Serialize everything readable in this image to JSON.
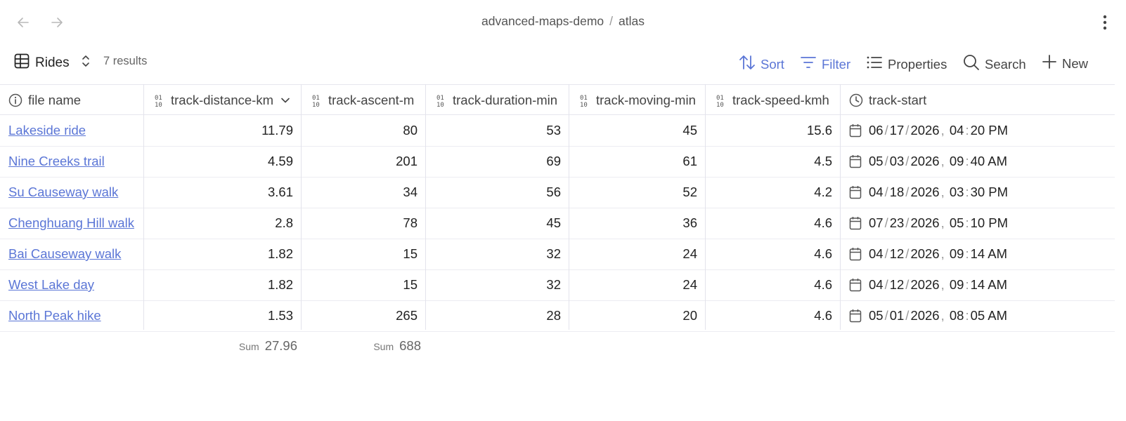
{
  "window": {
    "breadcrumb_project": "advanced-maps-demo",
    "breadcrumb_separator": "/",
    "breadcrumb_page": "atlas"
  },
  "toolbar": {
    "view_name": "Rides",
    "results": "7 results",
    "sort_label": "Sort",
    "filter_label": "Filter",
    "properties_label": "Properties",
    "search_label": "Search",
    "new_label": "New",
    "accent_color": "#5b76d6"
  },
  "table": {
    "columns": [
      {
        "label": "file name",
        "icon": "info-icon"
      },
      {
        "label": "track-distance-km",
        "icon": "number-icon"
      },
      {
        "label": "track-ascent-m",
        "icon": "number-icon"
      },
      {
        "label": "track-duration-min",
        "icon": "number-icon"
      },
      {
        "label": "track-moving-min",
        "icon": "number-icon"
      },
      {
        "label": "track-speed-kmh",
        "icon": "number-icon"
      },
      {
        "label": "track-start",
        "icon": "clock-icon"
      }
    ],
    "rows": [
      {
        "name": "Lakeside ride",
        "distance": "11.79",
        "ascent": "80",
        "duration": "53",
        "moving": "45",
        "speed": "15.6",
        "date": {
          "m": "06",
          "d": "17",
          "y": "2026",
          "h": "04",
          "min": "20 PM"
        }
      },
      {
        "name": "Nine Creeks trail",
        "distance": "4.59",
        "ascent": "201",
        "duration": "69",
        "moving": "61",
        "speed": "4.5",
        "date": {
          "m": "05",
          "d": "03",
          "y": "2026",
          "h": "09",
          "min": "40 AM"
        }
      },
      {
        "name": "Su Causeway walk",
        "distance": "3.61",
        "ascent": "34",
        "duration": "56",
        "moving": "52",
        "speed": "4.2",
        "date": {
          "m": "04",
          "d": "18",
          "y": "2026",
          "h": "03",
          "min": "30 PM"
        }
      },
      {
        "name": "Chenghuang Hill walk",
        "distance": "2.8",
        "ascent": "78",
        "duration": "45",
        "moving": "36",
        "speed": "4.6",
        "date": {
          "m": "07",
          "d": "23",
          "y": "2026",
          "h": "05",
          "min": "10 PM"
        }
      },
      {
        "name": "Bai Causeway walk",
        "distance": "1.82",
        "ascent": "15",
        "duration": "32",
        "moving": "24",
        "speed": "4.6",
        "date": {
          "m": "04",
          "d": "12",
          "y": "2026",
          "h": "09",
          "min": "14 AM"
        }
      },
      {
        "name": "West Lake day",
        "distance": "1.82",
        "ascent": "15",
        "duration": "32",
        "moving": "24",
        "speed": "4.6",
        "date": {
          "m": "04",
          "d": "12",
          "y": "2026",
          "h": "09",
          "min": "14 AM"
        }
      },
      {
        "name": "North Peak hike",
        "distance": "1.53",
        "ascent": "265",
        "duration": "28",
        "moving": "20",
        "speed": "4.6",
        "date": {
          "m": "05",
          "d": "01",
          "y": "2026",
          "h": "08",
          "min": "05 AM"
        }
      }
    ],
    "sums": {
      "label": "Sum",
      "distance": "27.96",
      "ascent": "688"
    }
  }
}
